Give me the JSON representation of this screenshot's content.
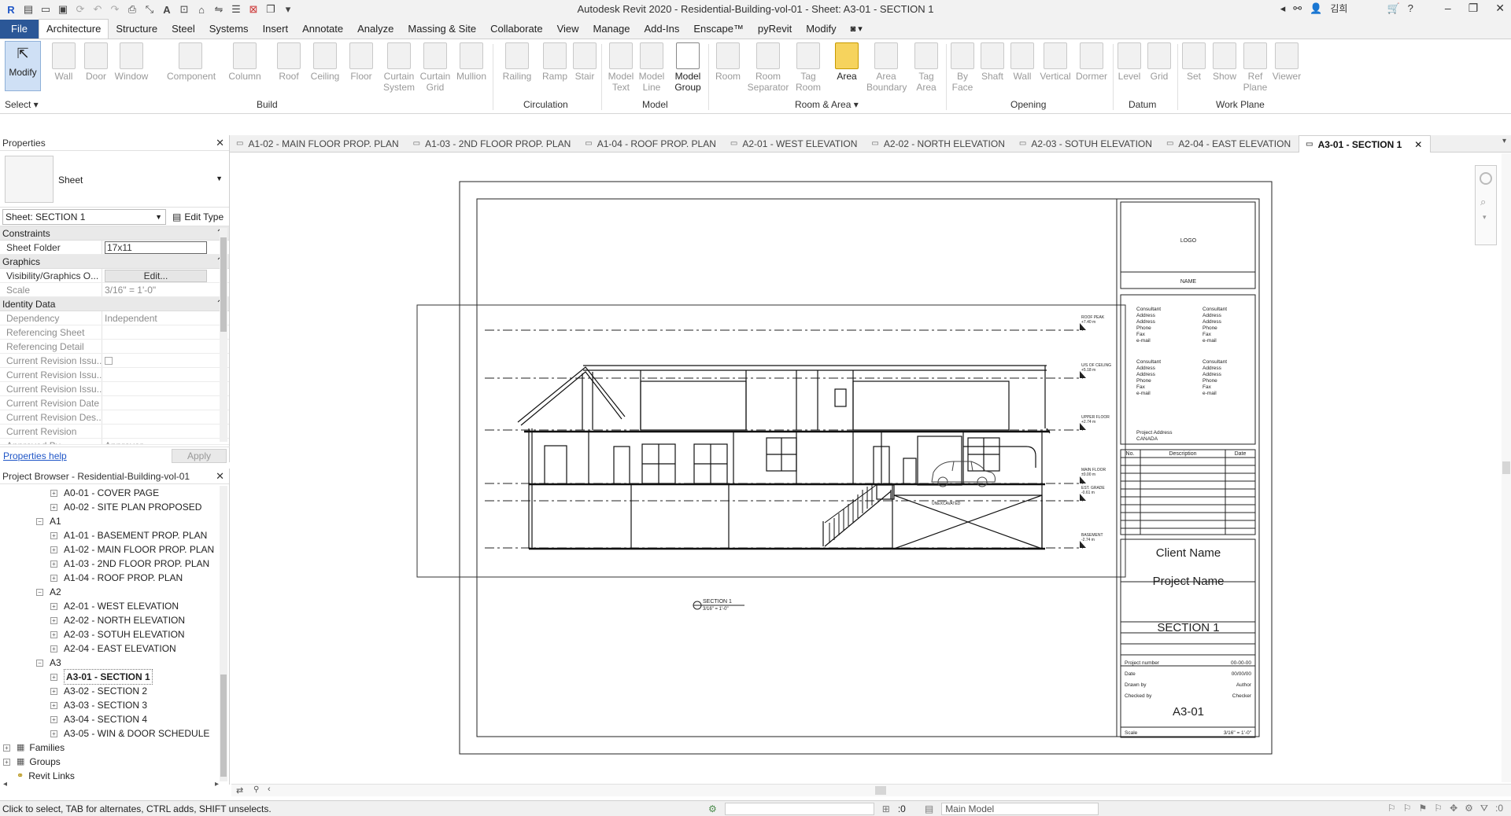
{
  "window": {
    "title": "Autodesk Revit 2020 - Residential-Building-vol-01 - Sheet: A3-01 - SECTION 1",
    "user": "김희",
    "minimize": "–",
    "restore": "❐",
    "close": "✕"
  },
  "ribbon_tabs": [
    "File",
    "Architecture",
    "Structure",
    "Steel",
    "Systems",
    "Insert",
    "Annotate",
    "Analyze",
    "Massing & Site",
    "Collaborate",
    "View",
    "Manage",
    "Add-Ins",
    "Enscape™",
    "pyRevit",
    "Modify"
  ],
  "ribbon": {
    "tools": [
      {
        "label": "Modify",
        "sub": ""
      },
      {
        "label": "Wall",
        "sub": ""
      },
      {
        "label": "Door",
        "sub": ""
      },
      {
        "label": "Window",
        "sub": ""
      },
      {
        "label": "Component",
        "sub": ""
      },
      {
        "label": "Column",
        "sub": ""
      },
      {
        "label": "Roof",
        "sub": ""
      },
      {
        "label": "Ceiling",
        "sub": ""
      },
      {
        "label": "Floor",
        "sub": ""
      },
      {
        "label": "Curtain",
        "sub": "System"
      },
      {
        "label": "Curtain",
        "sub": "Grid"
      },
      {
        "label": "Mullion",
        "sub": ""
      },
      {
        "label": "Railing",
        "sub": ""
      },
      {
        "label": "Ramp",
        "sub": ""
      },
      {
        "label": "Stair",
        "sub": ""
      },
      {
        "label": "Model",
        "sub": "Text"
      },
      {
        "label": "Model",
        "sub": "Line"
      },
      {
        "label": "Model",
        "sub": "Group"
      },
      {
        "label": "Room",
        "sub": ""
      },
      {
        "label": "Room",
        "sub": "Separator"
      },
      {
        "label": "Tag",
        "sub": "Room"
      },
      {
        "label": "Area",
        "sub": ""
      },
      {
        "label": "Area",
        "sub": "Boundary"
      },
      {
        "label": "Tag",
        "sub": "Area"
      },
      {
        "label": "By",
        "sub": "Face"
      },
      {
        "label": "Shaft",
        "sub": ""
      },
      {
        "label": "Wall",
        "sub": ""
      },
      {
        "label": "Vertical",
        "sub": ""
      },
      {
        "label": "Dormer",
        "sub": ""
      },
      {
        "label": "Level",
        "sub": ""
      },
      {
        "label": "Grid",
        "sub": ""
      },
      {
        "label": "Set",
        "sub": ""
      },
      {
        "label": "Show",
        "sub": ""
      },
      {
        "label": "Ref",
        "sub": "Plane"
      },
      {
        "label": "Viewer",
        "sub": ""
      }
    ],
    "groups": [
      "Select ▾",
      "Build",
      "Circulation",
      "Model",
      "Room & Area ▾",
      "Opening",
      "Datum",
      "Work Plane"
    ]
  },
  "properties": {
    "title": "Properties",
    "type_name": "Sheet",
    "instance_selector": "Sheet: SECTION 1",
    "edit_type": "Edit Type",
    "categories": {
      "constraints": "Constraints",
      "graphics": "Graphics",
      "identity": "Identity Data"
    },
    "rows": {
      "sheet_folder_k": "Sheet Folder",
      "sheet_folder_v": "17x11",
      "vis_k": "Visibility/Graphics O...",
      "vis_v": "Edit...",
      "scale_k": "Scale",
      "scale_v": "3/16\" = 1'-0\"",
      "dep_k": "Dependency",
      "dep_v": "Independent",
      "refsheet_k": "Referencing Sheet",
      "refdetail_k": "Referencing Detail",
      "cri_k": "Current Revision Issu...",
      "cri2_k": "Current Revision Issu...",
      "cri3_k": "Current Revision Issu...",
      "crd_k": "Current Revision Date",
      "crdes_k": "Current Revision Des...",
      "cr_k": "Current Revision",
      "appr_k": "Approved By",
      "appr_v": "Approver"
    },
    "help": "Properties help",
    "apply": "Apply"
  },
  "browser": {
    "title": "Project Browser - Residential-Building-vol-01",
    "items": [
      {
        "label": "A0-01 - COVER PAGE",
        "level": 2
      },
      {
        "label": "A0-02 - SITE PLAN PROPOSED",
        "level": 2
      },
      {
        "label": "A1",
        "level": 1
      },
      {
        "label": "A1-01 - BASEMENT PROP. PLAN",
        "level": 2
      },
      {
        "label": "A1-02 - MAIN FLOOR PROP. PLAN",
        "level": 2
      },
      {
        "label": "A1-03 - 2ND FLOOR PROP. PLAN",
        "level": 2
      },
      {
        "label": "A1-04 - ROOF PROP. PLAN",
        "level": 2
      },
      {
        "label": "A2",
        "level": 1
      },
      {
        "label": "A2-01 - WEST ELEVATION",
        "level": 2
      },
      {
        "label": "A2-02 - NORTH ELEVATION",
        "level": 2
      },
      {
        "label": "A2-03 - SOTUH ELEVATION",
        "level": 2
      },
      {
        "label": "A2-04 - EAST ELEVATION",
        "level": 2
      },
      {
        "label": "A3",
        "level": 1
      },
      {
        "label": "A3-01 - SECTION 1",
        "level": 2
      },
      {
        "label": "A3-02 - SECTION 2",
        "level": 2
      },
      {
        "label": "A3-03 - SECTION 3",
        "level": 2
      },
      {
        "label": "A3-04 - SECTION 4",
        "level": 2
      },
      {
        "label": "A3-05 - WIN & DOOR SCHEDULE",
        "level": 2
      },
      {
        "label": "Families",
        "level": 0
      },
      {
        "label": "Groups",
        "level": 0
      },
      {
        "label": "Revit Links",
        "level": 0
      }
    ]
  },
  "view_tabs": [
    "A1-02 - MAIN FLOOR PROP. PLAN",
    "A1-03 - 2ND FLOOR PROP. PLAN",
    "A1-04 - ROOF PROP. PLAN",
    "A2-01 - WEST ELEVATION",
    "A2-02 - NORTH ELEVATION",
    "A2-03 - SOTUH ELEVATION",
    "A2-04 - EAST ELEVATION",
    "A3-01 - SECTION 1"
  ],
  "sheet": {
    "logo": "LOGO",
    "name": "NAME",
    "consultant_block": [
      "Consultant",
      "Address",
      "Address",
      "Phone",
      "Fax",
      "e-mail"
    ],
    "project_address": "Project Address",
    "country": "CANADA",
    "rev_headers": [
      "No.",
      "Description",
      "Date"
    ],
    "client_name": "Client Name",
    "project_name": "Project Name",
    "sheet_title": "SECTION 1",
    "info_rows": [
      {
        "k": "Project number",
        "v": "00-00-00"
      },
      {
        "k": "Date",
        "v": "00/00/00"
      },
      {
        "k": "Drawn by",
        "v": "Author"
      },
      {
        "k": "Checked by",
        "v": "Checker"
      }
    ],
    "sheet_number": "A3-01",
    "scale_label": "Scale",
    "scale_value": "3/16\" = 1'-0\"",
    "section_tag": "SECTION 1",
    "section_scale": "3/16\" = 1'-0\"",
    "unexcavated": "UNEXCAVATED",
    "levels": [
      {
        "name": "ROOF PEAK",
        "elev": "+7.40 m"
      },
      {
        "name": "U/S OF CEILING",
        "elev": "+5.18 m"
      },
      {
        "name": "UPPER FLOOR",
        "elev": "+2.74 m"
      },
      {
        "name": "MAIN FLOOR",
        "elev": "±0.00 m"
      },
      {
        "name": "EST. GRADE",
        "elev": "-0.61 m"
      },
      {
        "name": "BASEMENT",
        "elev": "-2.74 m"
      }
    ]
  },
  "status": {
    "message": "Click to select, TAB for alternates, CTRL adds, SHIFT unselects.",
    "count": ":0",
    "model": "Main Model",
    "filter_count": ":0"
  }
}
